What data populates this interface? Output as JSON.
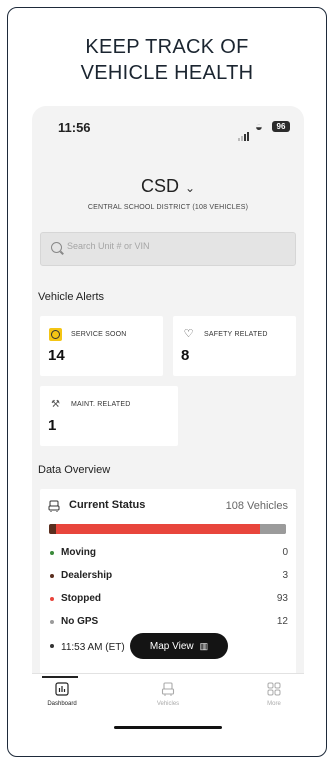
{
  "headline": {
    "line1": "KEEP TRACK OF",
    "line2": "VEHICLE HEALTH"
  },
  "status_bar": {
    "time": "11:56",
    "battery": "96"
  },
  "org": {
    "name": "CSD",
    "subtitle": "CENTRAL SCHOOL DISTRICT (108 VEHICLES)"
  },
  "search": {
    "placeholder": "Search Unit # or VIN"
  },
  "vehicle_alerts": {
    "title": "Vehicle Alerts",
    "items": [
      {
        "label": "SERVICE SOON",
        "value": "14",
        "icon": "clock-icon",
        "color": "#f4c514"
      },
      {
        "label": "SAFETY RELATED",
        "value": "8",
        "icon": "heart-icon"
      },
      {
        "label": "MAINT. RELATED",
        "value": "1",
        "icon": "wrench-icon"
      }
    ]
  },
  "data_overview": {
    "title": "Data Overview",
    "current_status_label": "Current Status",
    "total_label": "108 Vehicles",
    "statuses": [
      {
        "name": "Moving",
        "count": "0",
        "color": "#3a8a3a"
      },
      {
        "name": "Dealership",
        "count": "3",
        "color": "#5a2e1e"
      },
      {
        "name": "Stopped",
        "count": "93",
        "color": "#e8453c"
      },
      {
        "name": "No GPS",
        "count": "12",
        "color": "#9b9b9b"
      }
    ],
    "timestamp": "11:53 AM (ET)"
  },
  "map_button": {
    "label": "Map View"
  },
  "tabs": [
    {
      "label": "Dashboard",
      "active": true
    },
    {
      "label": "Vehicles",
      "active": false
    },
    {
      "label": "More",
      "active": false
    }
  ]
}
